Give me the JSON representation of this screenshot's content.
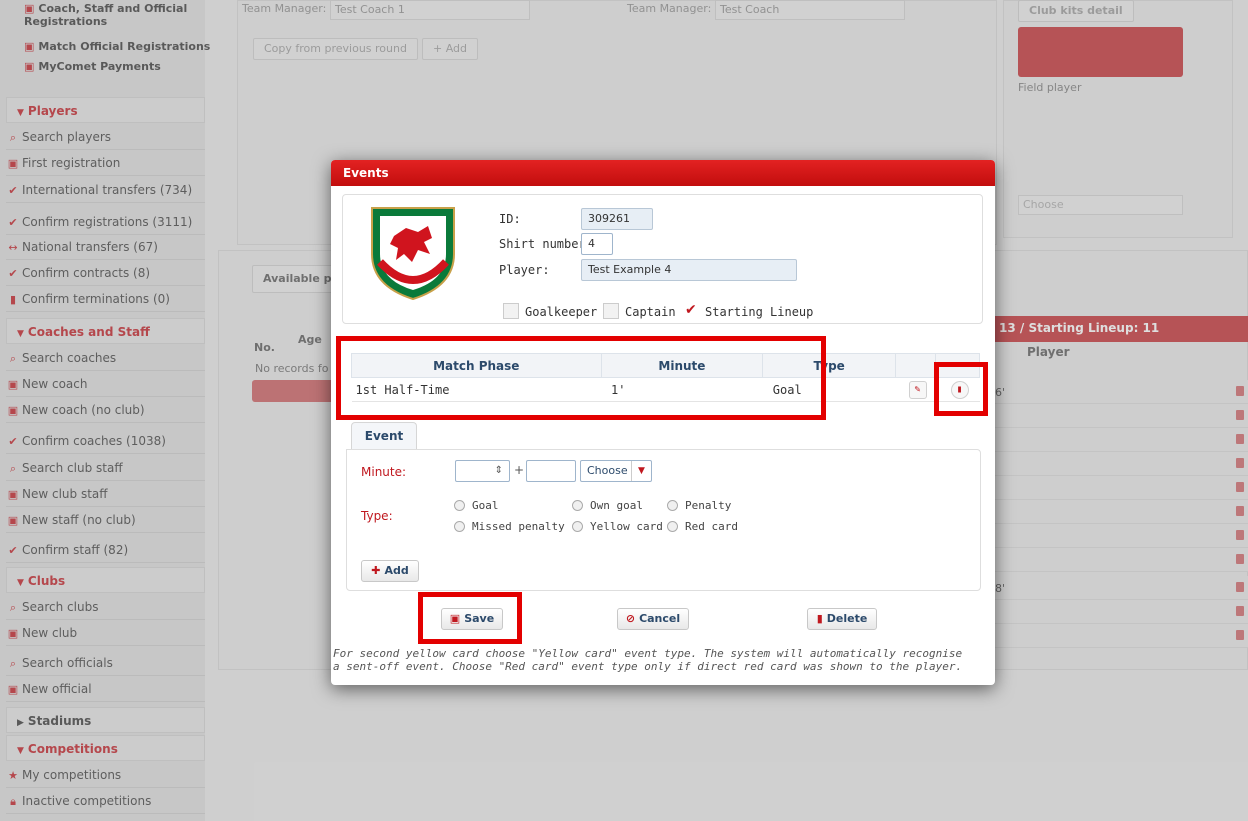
{
  "sidebar": {
    "items_top": [
      {
        "icon": "document-icon",
        "label": "Coach, Staff and Official Registrations"
      },
      {
        "icon": "document-icon",
        "label": "Match Official Registrations"
      },
      {
        "icon": "document-icon",
        "label": "MyComet Payments"
      }
    ],
    "players_header": "Players",
    "players_items": [
      {
        "label": "Search players"
      },
      {
        "label": "First registration"
      },
      {
        "label": "International transfers (734)"
      },
      {
        "label": "Confirm registrations (3111)"
      },
      {
        "label": "National transfers (67)"
      },
      {
        "label": "Confirm contracts (8)"
      },
      {
        "label": "Confirm terminations (0)"
      }
    ],
    "coaches_header": "Coaches and Staff",
    "coaches_items": [
      {
        "label": "Search coaches"
      },
      {
        "label": "New coach"
      },
      {
        "label": "New coach (no club)"
      },
      {
        "label": "Confirm coaches (1038)"
      },
      {
        "label": "Search club staff"
      },
      {
        "label": "New club staff"
      },
      {
        "label": "New staff (no club)"
      },
      {
        "label": "Confirm staff (82)"
      }
    ],
    "clubs_header": "Clubs",
    "clubs_items": [
      {
        "label": "Search clubs"
      },
      {
        "label": "New club"
      },
      {
        "label": "Search officials"
      },
      {
        "label": "New official"
      }
    ],
    "stadiums_header": "Stadiums",
    "competitions_header": "Competitions",
    "competitions_items": [
      {
        "label": "My competitions"
      },
      {
        "label": "Inactive competitions"
      }
    ]
  },
  "background": {
    "team_manager_label_1": "Team Manager:",
    "team_manager_value_1": "Test Coach 1",
    "team_manager_label_2": "Team Manager:",
    "team_manager_value_2": "Test Coach",
    "copy_button": "Copy from previous round",
    "add_button": "+ Add",
    "club_kits": "Club kits detail",
    "field_player": "Field player",
    "choose": "Choose",
    "available_tab": "Available p",
    "no_col": "No.",
    "age_col": "Age",
    "no_records": "No records fo",
    "lineup_header": "13 / Starting Lineup: 11",
    "player_col": "Player",
    "row_values": [
      "6'",
      "8'"
    ]
  },
  "modal": {
    "title": "Events",
    "id_label": "ID:",
    "id_value": "309261",
    "shirt_label": "Shirt number:",
    "shirt_value": "4",
    "player_label": "Player:",
    "player_value": "Test Example 4",
    "checkboxes": [
      {
        "label": "Goalkeeper",
        "checked": false
      },
      {
        "label": "Captain",
        "checked": false
      },
      {
        "label": "Starting Lineup",
        "checked": true
      }
    ],
    "table": {
      "headers": [
        "Match Phase",
        "Minute",
        "Type"
      ],
      "rows": [
        {
          "phase": "1st Half-Time",
          "minute": "1'",
          "type": "Goal"
        }
      ]
    },
    "event_tab": "Event",
    "minute_label": "Minute:",
    "plus_sign": "+",
    "choose": "Choose",
    "type_label": "Type:",
    "types": [
      "Goal",
      "Own goal",
      "Penalty",
      "Missed penalty",
      "Yellow card",
      "Red card"
    ],
    "add_button": "Add",
    "save_button": "Save",
    "cancel_button": "Cancel",
    "delete_button": "Delete",
    "note": "For second yellow card choose \"Yellow card\" event type. The system will automatically recognise a sent-off event. Choose \"Red card\" event type only if direct red card was shown to the player."
  },
  "colors": {
    "accent_red": "#c0181f",
    "highlight_red": "#e30000",
    "title_red": "#d41616"
  }
}
